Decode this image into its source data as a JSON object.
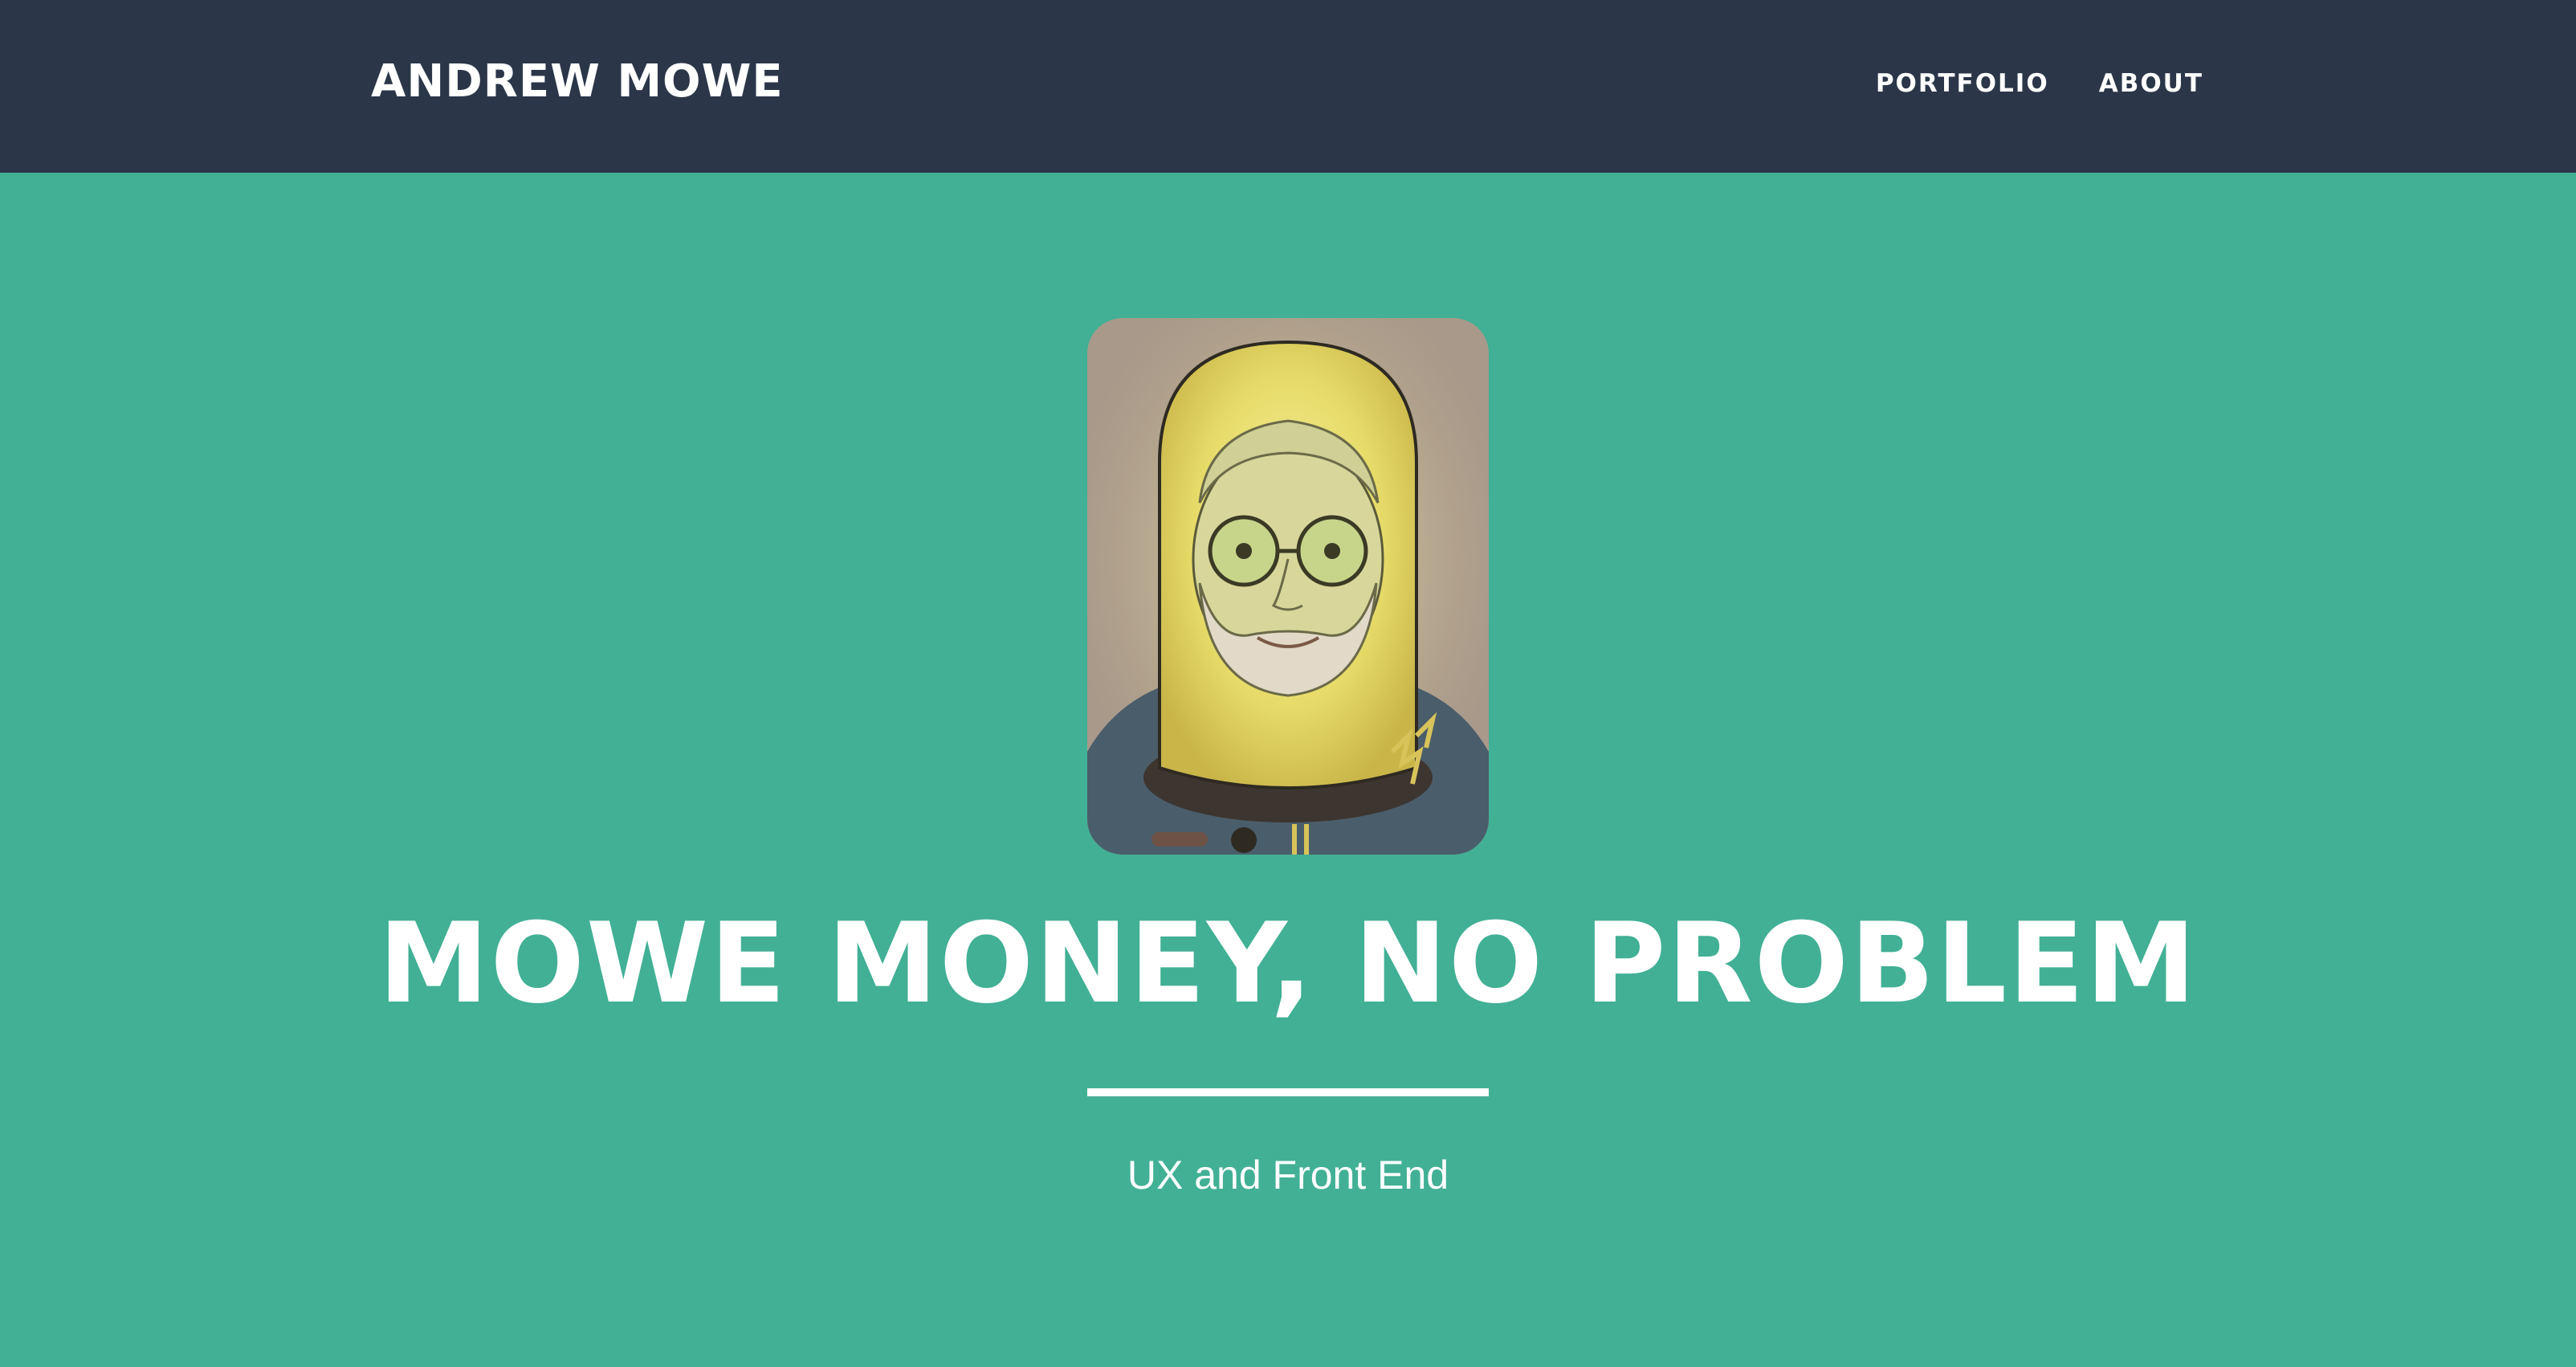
{
  "header": {
    "brand": "ANDREW MOWE",
    "nav": [
      {
        "label": "PORTFOLIO"
      },
      {
        "label": "ABOUT"
      }
    ]
  },
  "hero": {
    "avatar_alt": "Illustrated portrait of a bearded man with glasses in a glowing astronaut helmet",
    "title": "MOWE MONEY, NO PROBLEM",
    "subtitle": "UX and Front End"
  },
  "colors": {
    "header_bg": "#2b3649",
    "hero_bg": "#42b095",
    "text": "#ffffff"
  }
}
